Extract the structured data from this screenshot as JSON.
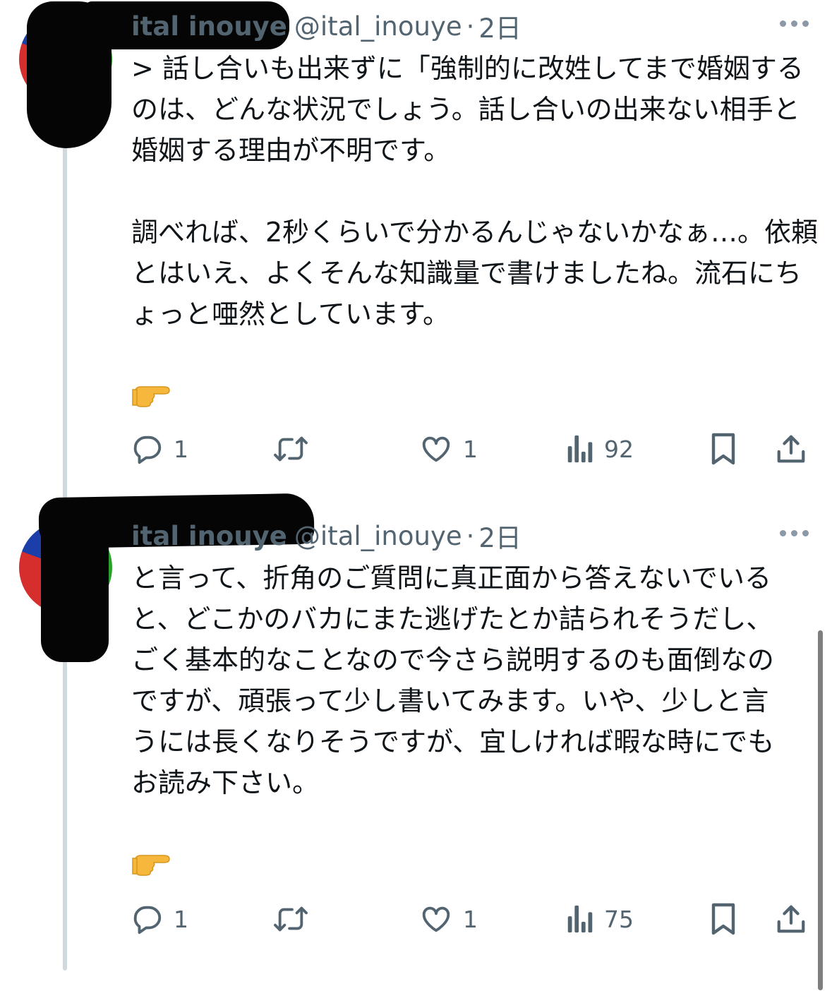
{
  "tweets": [
    {
      "display_name": "ital inouye",
      "handle": "@ital_inouye",
      "separator": "·",
      "time": "2日",
      "body": "> 話し合いも出来ずに「強制的に改姓してまで婚姻するのは、どんな状況でしょう。話し合いの出来ない相手と婚姻する理由が不明です。\n\n調べれば、2秒くらいで分かるんじゃないかなぁ…。依頼とはいえ、よくそんな知識量で書けましたね。流石にちょっと唖然としています。",
      "emoji": "👉",
      "replies": "1",
      "retweets": "",
      "likes": "1",
      "views": "92"
    },
    {
      "display_name": "ital inouye",
      "handle": "@ital_inouye",
      "separator": "·",
      "time": "2日",
      "body": "と言って、折角のご質問に真正面から答えないでいると、どこかのバカにまた逃げたとか詰られそうだし、ごく基本的なことなので今さら説明するのも面倒なのですが、頑張って少し書いてみます。いや、少しと言うには長くなりそうですが、宜しければ暇な時にでもお読み下さい。",
      "emoji": "👉",
      "replies": "1",
      "retweets": "",
      "likes": "1",
      "views": "75"
    }
  ],
  "icons": {
    "reply": "reply-icon",
    "retweet": "retweet-icon",
    "like": "heart-icon",
    "views": "views-icon",
    "bookmark": "bookmark-icon",
    "share": "share-icon",
    "more": "more-icon",
    "emoji": "pointing-right-icon"
  },
  "colors": {
    "text": "#0f1419",
    "secondary": "#536471",
    "thread_line": "#cfd9de",
    "background": "#ffffff"
  }
}
